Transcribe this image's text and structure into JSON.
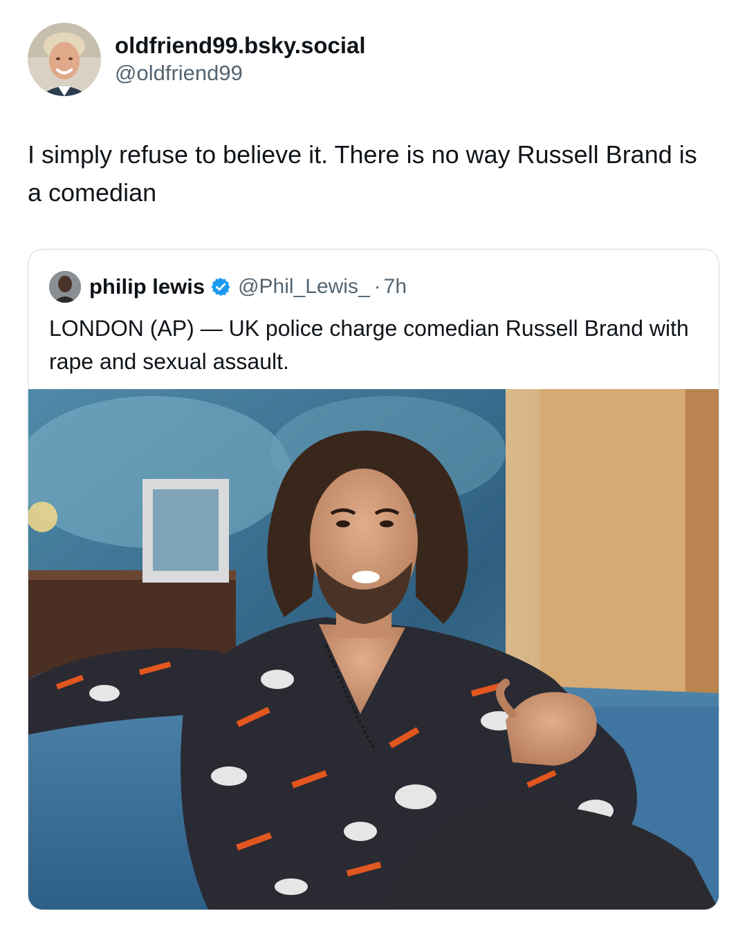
{
  "post": {
    "author_name": "oldfriend99.bsky.social",
    "author_handle": "@oldfriend99",
    "text": "I simply refuse to believe it. There is no way Russell Brand is a comedian"
  },
  "quoted_post": {
    "author_name": "philip lewis",
    "author_handle": "@Phil_Lewis_",
    "separator": "·",
    "time": "7h",
    "text": "LONDON (AP) — UK police charge comedian Russell Brand with rape and sexual assault.",
    "verified_color": "#1d9bf0",
    "image_icon": "photo-icon"
  },
  "colors": {
    "text_primary": "#0f1419",
    "text_secondary": "#536471",
    "border": "#cfd9de"
  }
}
